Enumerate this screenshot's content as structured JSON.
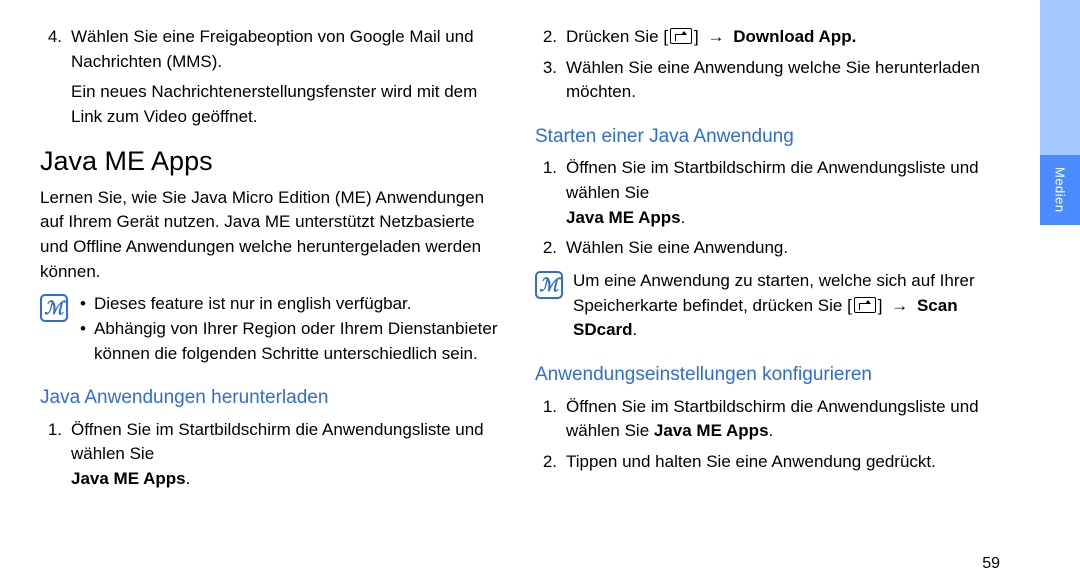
{
  "left": {
    "step4_num": "4.",
    "step4_text_a": "Wählen Sie eine Freigabeoption von Google Mail und Nachrichten (MMS).",
    "step4_text_b": "Ein neues Nachrichtenerstellungsfenster wird mit dem Link zum Video geöffnet.",
    "h1": "Java ME Apps",
    "intro": "Lernen Sie, wie Sie Java Micro Edition (ME) Anwendungen auf Ihrem Gerät nutzen. Java ME unterstützt Netzbasierte und Offline Anwendungen welche heruntergeladen werden können.",
    "note_b1": "Dieses feature ist nur in english verfügbar.",
    "note_b2": "Abhängig von Ihrer Region oder Ihrem Dienstanbieter können die folgenden Schritte unterschiedlich sein.",
    "h2_download": "Java Anwendungen herunterladen",
    "dl_step1_num": "1.",
    "dl_step1_text": "Öffnen Sie im Startbildschirm die Anwendungsliste und wählen Sie ",
    "dl_step1_bold": "Java ME Apps",
    "dl_step1_period": "."
  },
  "right": {
    "dl_step2_num": "2.",
    "dl_step2_pre": "Drücken Sie [",
    "dl_step2_post": "] ",
    "dl_step2_arrow": "→",
    "dl_step2_bold": " Download App.",
    "dl_step3_num": "3.",
    "dl_step3_text": "Wählen Sie eine Anwendung welche Sie herunterladen möchten.",
    "h2_start": "Starten einer Java Anwendung",
    "st_step1_num": "1.",
    "st_step1_text": "Öffnen Sie im Startbildschirm die Anwendungsliste und wählen Sie ",
    "st_step1_bold": "Java ME Apps",
    "st_step1_period": ".",
    "st_step2_num": "2.",
    "st_step2_text": "Wählen Sie eine Anwendung.",
    "note2_line1": "Um eine Anwendung zu starten, welche sich auf Ihrer Speicherkarte befindet, drücken Sie",
    "note2_pre": "[",
    "note2_post": "] ",
    "note2_arrow": "→",
    "note2_bold": " Scan SDcard",
    "note2_period": ".",
    "h2_cfg": "Anwendungseinstellungen konfigurieren",
    "cfg_step1_num": "1.",
    "cfg_step1_text": "Öffnen Sie im Startbildschirm die Anwendungsliste und wählen Sie ",
    "cfg_step1_bold": "Java ME Apps",
    "cfg_step1_period": ".",
    "cfg_step2_num": "2.",
    "cfg_step2_text": "Tippen und halten Sie eine Anwendung gedrückt."
  },
  "pagenum": "59",
  "sidelabel": "Medien"
}
